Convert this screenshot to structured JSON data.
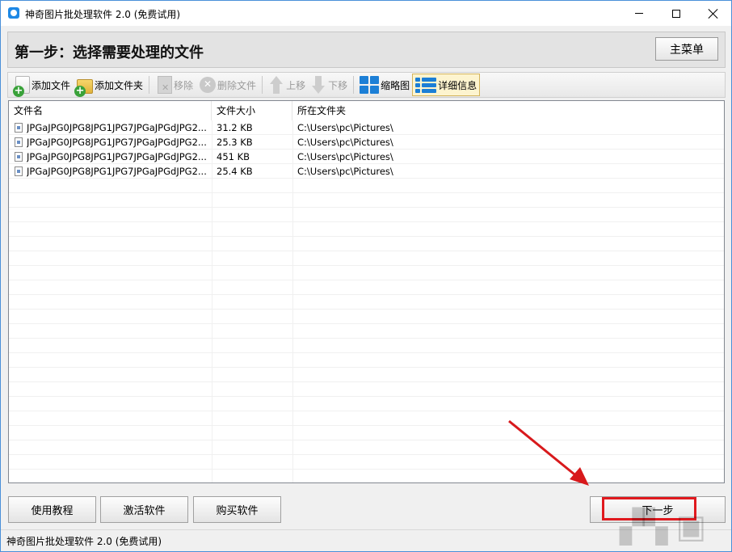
{
  "window": {
    "title": "神奇图片批处理软件 2.0 (免费试用)"
  },
  "header": {
    "step_title": "第一步：选择需要处理的文件",
    "main_menu_label": "主菜单"
  },
  "toolbar": {
    "add_file": "添加文件",
    "add_folder": "添加文件夹",
    "remove": "移除",
    "delete_file": "删除文件",
    "move_up": "上移",
    "move_down": "下移",
    "thumbnail": "缩略图",
    "details": "详细信息"
  },
  "file_list": {
    "columns": [
      "文件名",
      "文件大小",
      "所在文件夹"
    ],
    "rows": [
      {
        "name": "JPGaJPG0JPG8JPG1JPG7JPGaJPGdJPG2...",
        "size": "31.2 KB",
        "folder": "C:\\Users\\pc\\Pictures\\"
      },
      {
        "name": "JPGaJPG0JPG8JPG1JPG7JPGaJPGdJPG2...",
        "size": "25.3 KB",
        "folder": "C:\\Users\\pc\\Pictures\\"
      },
      {
        "name": "JPGaJPG0JPG8JPG1JPG7JPGaJPGdJPG2...",
        "size": "451 KB",
        "folder": "C:\\Users\\pc\\Pictures\\"
      },
      {
        "name": "JPGaJPG0JPG8JPG1JPG7JPGaJPGdJPG2...",
        "size": "25.4 KB",
        "folder": "C:\\Users\\pc\\Pictures\\"
      }
    ]
  },
  "footer": {
    "tutorial": "使用教程",
    "activate": "激活软件",
    "buy": "购买软件",
    "next_step": "下一步"
  },
  "status_bar": {
    "text": "神奇图片批处理软件 2.0 (免费试用)"
  },
  "colors": {
    "highlight": "#e0191e",
    "accent": "#1c7fd6"
  }
}
